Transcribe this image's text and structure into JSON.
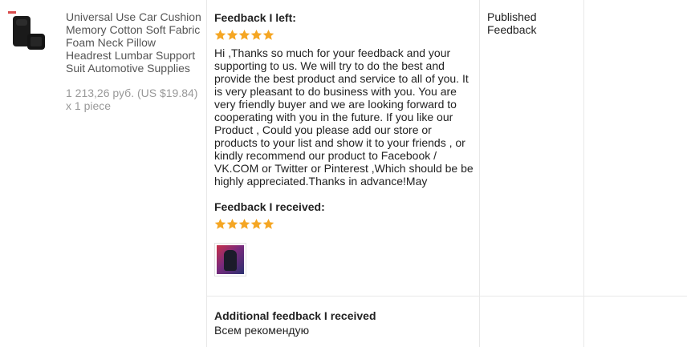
{
  "product": {
    "title": "Universal Use Car Cushion Memory Cotton Soft Fabric Foam Neck Pillow Headrest Lumbar Support Suit Automotive Supplies",
    "price": "1 213,26 руб. (US $19.84)",
    "quantity": "x 1 piece",
    "thumbnail_icon": "car-cushion-image"
  },
  "feedback_left": {
    "heading": "Feedback I left:",
    "rating": 5,
    "text": "Hi ,Thanks so much for your feedback and your supporting to us. We will try to do the best and provide the best product and service to all of you. It is very pleasant to do business with you. You are very friendly buyer and we are looking forward to cooperating with you in the future. If you like our Product , Could you please add our store or products to your list and show it to your friends , or kindly recommend our product to Facebook / VK.COM or Twitter or Pinterest ,Which should be be highly appreciated.Thanks in advance!May"
  },
  "feedback_received": {
    "heading": "Feedback I received:",
    "rating": 5,
    "photo_icon": "buyer-photo"
  },
  "additional_feedback": {
    "heading": "Additional feedback I received",
    "text": "Всем рекомендую"
  },
  "status": {
    "label": "Published Feedback"
  },
  "colors": {
    "star": "#f5a623",
    "separator": "#e8e8e8",
    "muted_text": "#999999"
  }
}
